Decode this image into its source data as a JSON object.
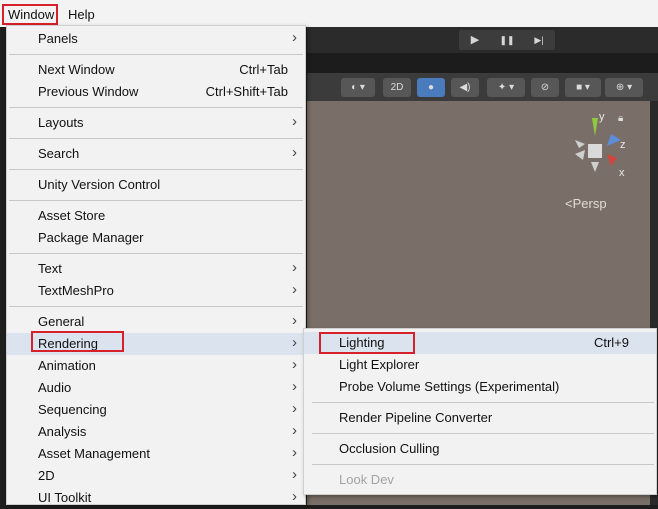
{
  "menubar": {
    "items": [
      "Window",
      "Help"
    ]
  },
  "playbar": {
    "play": "▶",
    "pause": "❚❚",
    "step": "▶|"
  },
  "toolbar": {
    "mode_2d": "2D"
  },
  "scene": {
    "persp_label": "<Persp",
    "axis_y": "y",
    "axis_z": "z",
    "axis_x": "x"
  },
  "window_menu": {
    "items": [
      {
        "label": "Panels",
        "shortcut": "",
        "submenu": true
      },
      {
        "label": "Next Window",
        "shortcut": "Ctrl+Tab",
        "submenu": false
      },
      {
        "label": "Previous Window",
        "shortcut": "Ctrl+Shift+Tab",
        "submenu": false
      },
      {
        "label": "Layouts",
        "shortcut": "",
        "submenu": true
      },
      {
        "label": "Search",
        "shortcut": "",
        "submenu": true
      },
      {
        "label": "Unity Version Control",
        "shortcut": "",
        "submenu": false
      },
      {
        "label": "Asset Store",
        "shortcut": "",
        "submenu": false
      },
      {
        "label": "Package Manager",
        "shortcut": "",
        "submenu": false
      },
      {
        "label": "Text",
        "shortcut": "",
        "submenu": true
      },
      {
        "label": "TextMeshPro",
        "shortcut": "",
        "submenu": true
      },
      {
        "label": "General",
        "shortcut": "",
        "submenu": true
      },
      {
        "label": "Rendering",
        "shortcut": "",
        "submenu": true
      },
      {
        "label": "Animation",
        "shortcut": "",
        "submenu": true
      },
      {
        "label": "Audio",
        "shortcut": "",
        "submenu": true
      },
      {
        "label": "Sequencing",
        "shortcut": "",
        "submenu": true
      },
      {
        "label": "Analysis",
        "shortcut": "",
        "submenu": true
      },
      {
        "label": "Asset Management",
        "shortcut": "",
        "submenu": true
      },
      {
        "label": "2D",
        "shortcut": "",
        "submenu": true
      },
      {
        "label": "UI Toolkit",
        "shortcut": "",
        "submenu": true
      }
    ]
  },
  "rendering_menu": {
    "items": [
      {
        "label": "Lighting",
        "shortcut": "Ctrl+9",
        "disabled": false
      },
      {
        "label": "Light Explorer",
        "shortcut": "",
        "disabled": false
      },
      {
        "label": "Probe Volume Settings (Experimental)",
        "shortcut": "",
        "disabled": false
      },
      {
        "label": "Render Pipeline Converter",
        "shortcut": "",
        "disabled": false
      },
      {
        "label": "Occlusion Culling",
        "shortcut": "",
        "disabled": false
      },
      {
        "label": "Look Dev",
        "shortcut": "",
        "disabled": true
      }
    ]
  },
  "colors": {
    "highlight_box": "#d6202a",
    "hover_row": "#dbe3ee",
    "scene_bg": "#7a6f68",
    "accent_blue": "#4a7bbd"
  }
}
